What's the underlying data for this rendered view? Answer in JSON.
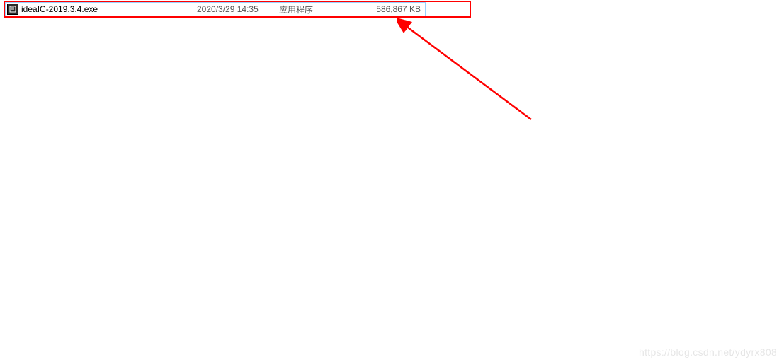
{
  "file": {
    "name": "ideaIC-2019.3.4.exe",
    "date": "2020/3/29 14:35",
    "type": "应用程序",
    "size": "586,867 KB"
  },
  "watermark": "https://blog.csdn.net/ydyrx808",
  "annotation": {
    "highlight_color": "#ff0000",
    "arrow_color": "#ff0000"
  }
}
